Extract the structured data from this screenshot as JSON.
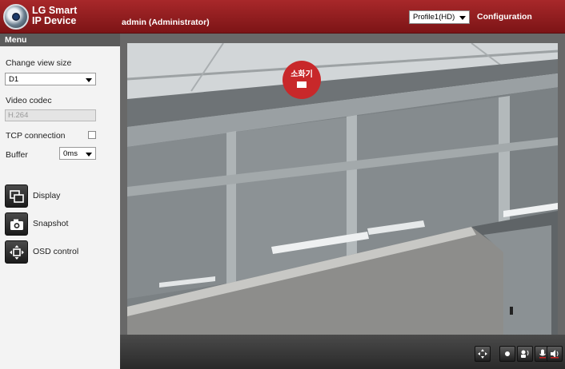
{
  "header": {
    "brand_line1": "LG Smart",
    "brand_line2": "IP Device",
    "user": "admin (Administrator)",
    "profile_value": "Profile1(HD)",
    "configuration": "Configuration",
    "accent": "#8b1a1c"
  },
  "menu": {
    "title": "Menu",
    "view_size_label": "Change view size",
    "view_size_value": "D1",
    "codec_label": "Video codec",
    "codec_value": "H.264",
    "tcp_label": "TCP connection",
    "tcp_checked": false,
    "buffer_label": "Buffer",
    "buffer_value": "0ms",
    "buttons": [
      {
        "label": "Display",
        "icon": "display-icon"
      },
      {
        "label": "Snapshot",
        "icon": "camera-icon"
      },
      {
        "label": "OSD control",
        "icon": "osd-move-icon"
      }
    ]
  },
  "video": {
    "sign_text": "소화기"
  },
  "controls": [
    {
      "icon": "fullscreen-icon"
    },
    {
      "icon": "record-icon"
    },
    {
      "icon": "talk-icon"
    },
    {
      "icon": "microphone-icon"
    },
    {
      "icon": "speaker-icon"
    }
  ]
}
